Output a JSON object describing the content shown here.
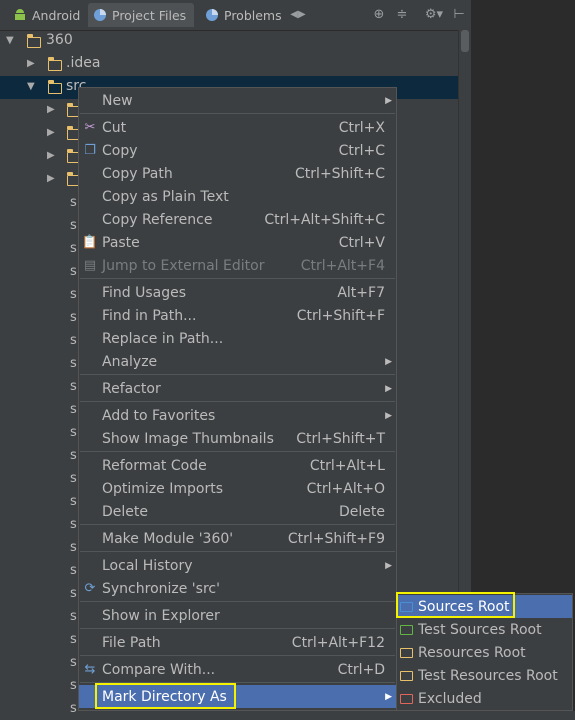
{
  "tabs": [
    {
      "label": "Android",
      "icon": "android-icon"
    },
    {
      "label": "Project Files",
      "icon": "project-files-icon",
      "active": true
    },
    {
      "label": "Problems",
      "icon": "problems-icon"
    }
  ],
  "tree": {
    "root": "360",
    "idea": ".idea",
    "src": "src",
    "file_letter": "s"
  },
  "context_menu": {
    "items": [
      {
        "label": "New",
        "shortcut": "",
        "submenu": true
      },
      {
        "label": "Cut",
        "shortcut": "Ctrl+X",
        "icon": "scissors-icon"
      },
      {
        "label": "Copy",
        "shortcut": "Ctrl+C",
        "icon": "copy-icon"
      },
      {
        "label": "Copy Path",
        "shortcut": "Ctrl+Shift+C"
      },
      {
        "label": "Copy as Plain Text",
        "shortcut": ""
      },
      {
        "label": "Copy Reference",
        "shortcut": "Ctrl+Alt+Shift+C"
      },
      {
        "label": "Paste",
        "shortcut": "Ctrl+V",
        "icon": "paste-icon"
      },
      {
        "label": "Jump to External Editor",
        "shortcut": "Ctrl+Alt+F4",
        "disabled": true,
        "icon": "external-editor-icon"
      },
      {
        "label": "Find Usages",
        "shortcut": "Alt+F7"
      },
      {
        "label": "Find in Path...",
        "shortcut": "Ctrl+Shift+F"
      },
      {
        "label": "Replace in Path...",
        "shortcut": ""
      },
      {
        "label": "Analyze",
        "shortcut": "",
        "submenu": true
      },
      {
        "label": "Refactor",
        "shortcut": "",
        "submenu": true
      },
      {
        "label": "Add to Favorites",
        "shortcut": "",
        "submenu": true
      },
      {
        "label": "Show Image Thumbnails",
        "shortcut": "Ctrl+Shift+T"
      },
      {
        "label": "Reformat Code",
        "shortcut": "Ctrl+Alt+L"
      },
      {
        "label": "Optimize Imports",
        "shortcut": "Ctrl+Alt+O"
      },
      {
        "label": "Delete",
        "shortcut": "Delete"
      },
      {
        "label": "Make Module '360'",
        "shortcut": "Ctrl+Shift+F9"
      },
      {
        "label": "Local History",
        "shortcut": "",
        "submenu": true
      },
      {
        "label": "Synchronize 'src'",
        "shortcut": "",
        "icon": "sync-icon"
      },
      {
        "label": "Show in Explorer",
        "shortcut": ""
      },
      {
        "label": "File Path",
        "shortcut": "Ctrl+Alt+F12"
      },
      {
        "label": "Compare With...",
        "shortcut": "Ctrl+D",
        "icon": "compare-icon"
      },
      {
        "label": "Mark Directory As",
        "shortcut": "",
        "submenu": true,
        "highlighted": true
      }
    ]
  },
  "mark_submenu": {
    "items": [
      {
        "label": "Sources Root",
        "color": "#4a8fd4",
        "highlighted": true
      },
      {
        "label": "Test Sources Root",
        "color": "#62b543"
      },
      {
        "label": "Resources Root",
        "color": "#e8bf6a"
      },
      {
        "label": "Test Resources Root",
        "color": "#e8bf6a"
      },
      {
        "label": "Excluded",
        "color": "#e0655a"
      }
    ]
  },
  "colors": {
    "accent": "#4b6eaf",
    "highlight_box": "#f5f200",
    "folder": "#e8bf6a"
  }
}
